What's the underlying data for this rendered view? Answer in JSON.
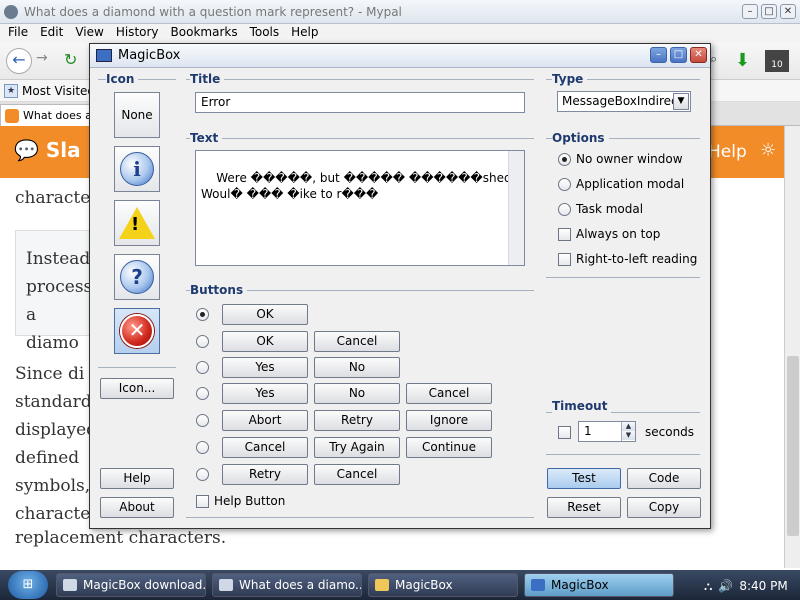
{
  "browser": {
    "window_title": "What does a diamond with a question mark represent? - Mypal",
    "menu": [
      "File",
      "Edit",
      "View",
      "History",
      "Bookmarks",
      "Tools",
      "Help"
    ],
    "bookmark_label": "Most Visited",
    "tab_label": "What does a",
    "addon_badge": "10",
    "banner_brand": "Sla",
    "banner_help": "Help",
    "content": {
      "line1": "characte",
      "note_lines": [
        "Instead",
        "process",
        "a diamo"
      ],
      "body_lines": [
        "Since   di",
        "standard",
        "displayed",
        "defined",
        "symbols,",
        "characte"
      ],
      "last_line": "replacement characters."
    }
  },
  "dialog": {
    "title": "MagicBox",
    "icon_group": {
      "label": "Icon",
      "none_label": "None",
      "icon_button": "Icon..."
    },
    "title_group": {
      "label": "Title",
      "value": "Error"
    },
    "text_group": {
      "label": "Text",
      "value": "Were �����, but ����� ������shed.\nWoul� ��� �ike to r���"
    },
    "type_group": {
      "label": "Type",
      "selected": "MessageBoxIndirect"
    },
    "options_group": {
      "label": "Options",
      "radios": [
        "No owner window",
        "Application modal",
        "Task modal"
      ],
      "checks": [
        "Always on top",
        "Right-to-left reading"
      ]
    },
    "buttons_group": {
      "label": "Buttons",
      "rows": [
        [
          "OK"
        ],
        [
          "OK",
          "Cancel"
        ],
        [
          "Yes",
          "No"
        ],
        [
          "Yes",
          "No",
          "Cancel"
        ],
        [
          "Abort",
          "Retry",
          "Ignore"
        ],
        [
          "Cancel",
          "Try Again",
          "Continue"
        ],
        [
          "Retry",
          "Cancel"
        ]
      ],
      "help_button_label": "Help Button"
    },
    "timeout_group": {
      "label": "Timeout",
      "value": "1",
      "unit": "seconds"
    },
    "actions": {
      "test": "Test",
      "code": "Code",
      "reset": "Reset",
      "copy": "Copy",
      "help": "Help",
      "about": "About"
    }
  },
  "taskbar": {
    "items": [
      "MagicBox download...",
      "What does a diamo...",
      "MagicBox",
      "MagicBox"
    ],
    "clock": "8:40 PM"
  }
}
